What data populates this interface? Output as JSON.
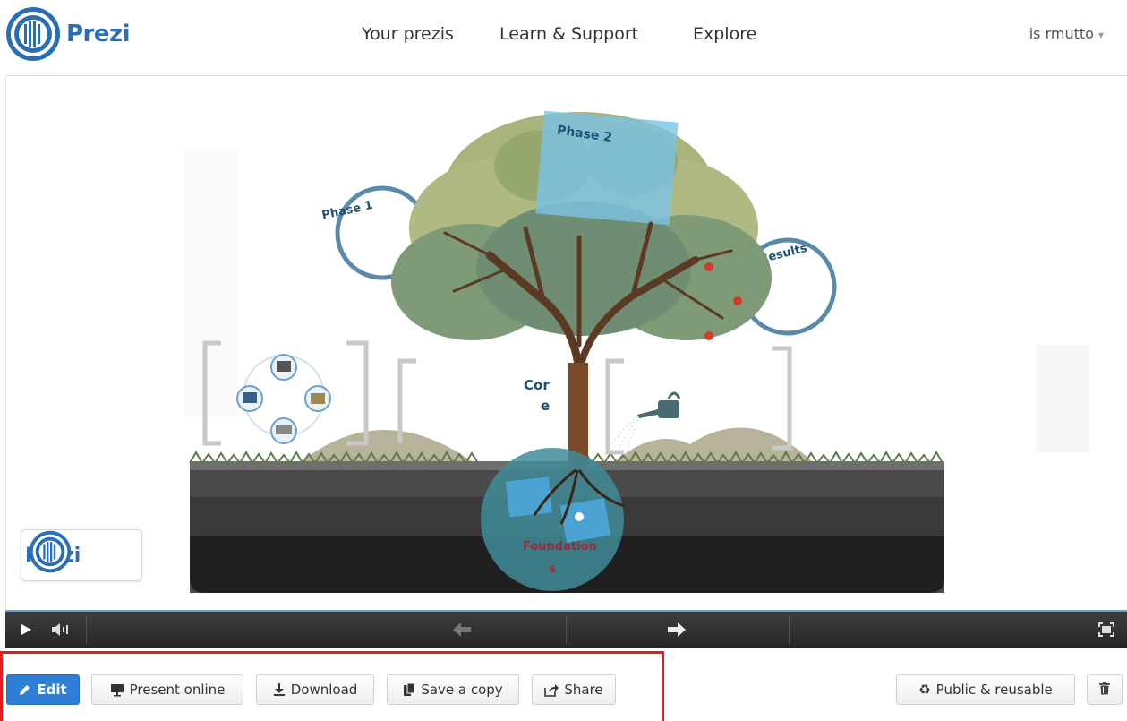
{
  "header": {
    "logo_text": "Prezi",
    "nav": [
      "Your prezis",
      "Learn & Support",
      "Explore"
    ],
    "user": "is rmutto"
  },
  "canvas": {
    "labels": {
      "phase1": "Phase 1",
      "phase2": "Phase 2",
      "results": "Results",
      "core_top": "Cor",
      "core_bottom": "e",
      "foundation_top": "Foundation",
      "foundation_bottom": "s"
    },
    "badge_text": "Prezi"
  },
  "player": {
    "icons": [
      "play-icon",
      "volume-icon",
      "previous-arrow-icon",
      "next-arrow-icon",
      "fullscreen-icon"
    ]
  },
  "toolbar": {
    "edit": "Edit",
    "present_online": "Present online",
    "download": "Download",
    "save_copy": "Save a copy",
    "share": "Share",
    "public_reusable": "Public & reusable"
  },
  "colors": {
    "brand_blue": "#2a6eb6",
    "edit_blue": "#2f7fd7",
    "highlight_red": "#e21b1b",
    "player_bar": "#2e2e2e"
  }
}
